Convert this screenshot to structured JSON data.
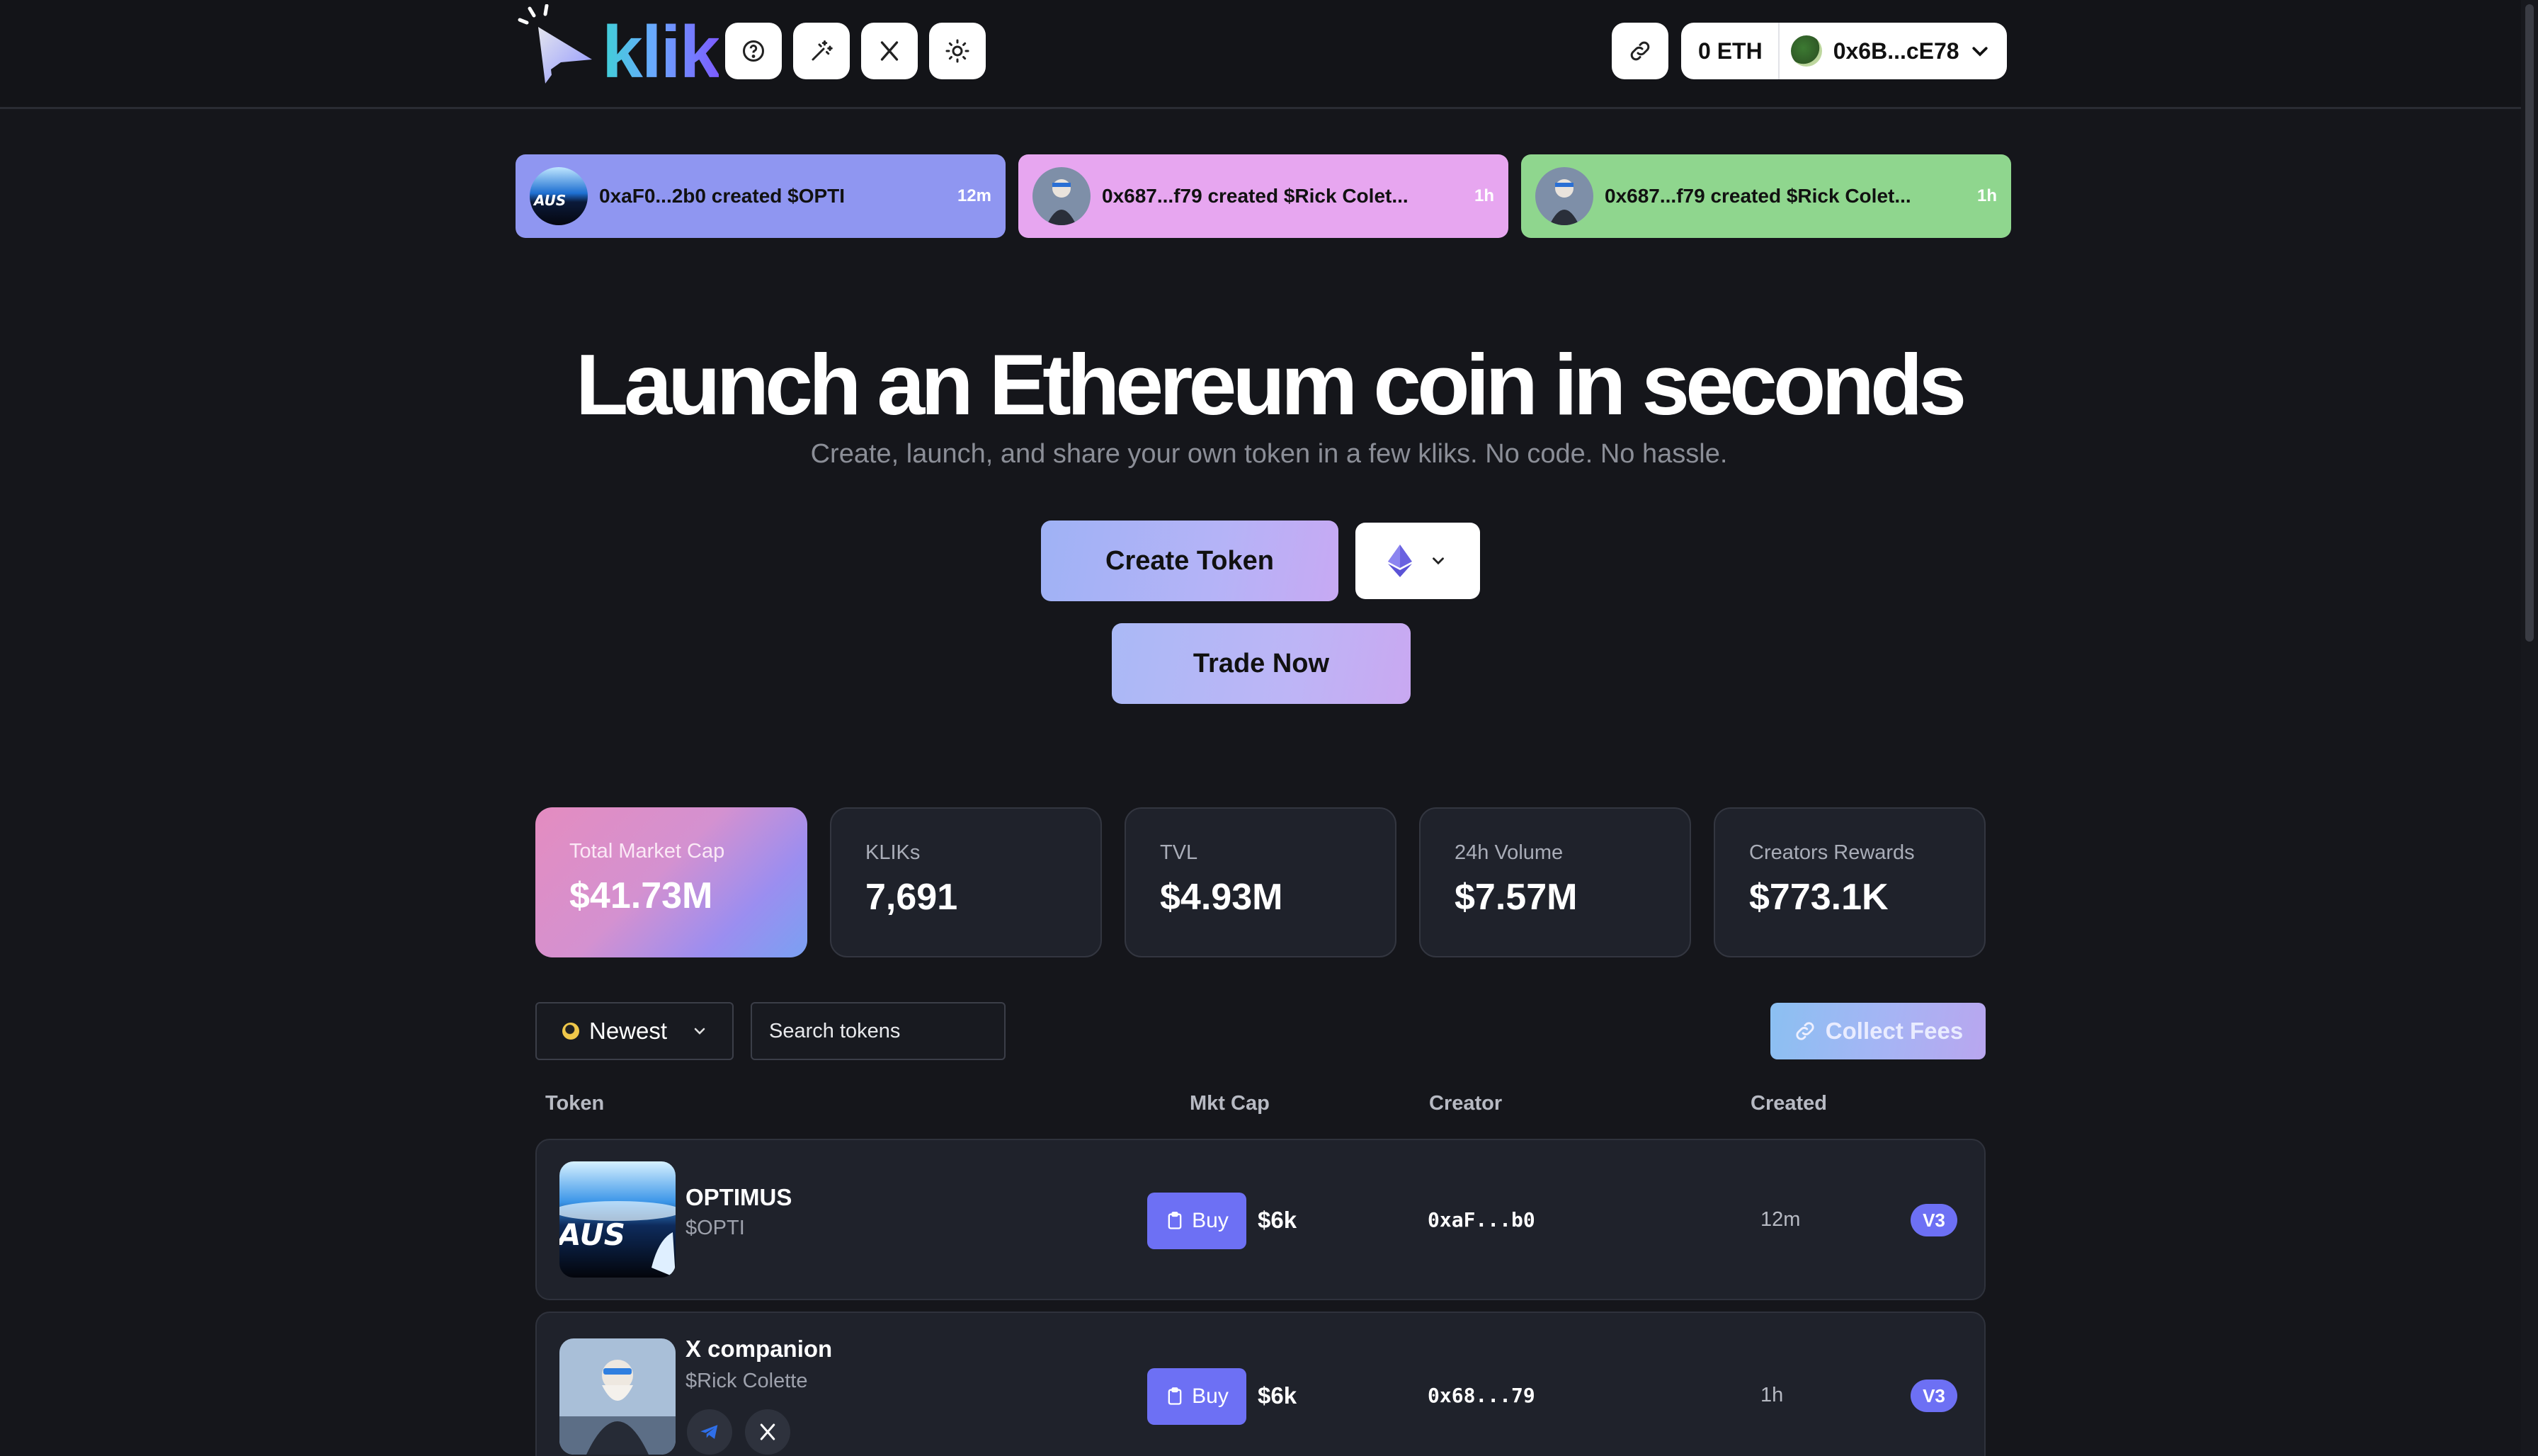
{
  "header": {
    "logo_text": "klik",
    "help_icon": "question-circle-icon",
    "tool_icon": "wand-icon",
    "x_icon": "x-logo-icon",
    "theme_icon": "sun-icon",
    "link_icon": "link-icon",
    "wallet": {
      "balance": "0 ETH",
      "address": "0x6B...cE78"
    }
  },
  "ticker": [
    {
      "text": "0xaF0...2b0 created $OPTI",
      "time": "12m",
      "color": "#8f96f1"
    },
    {
      "text": "0x687...f79 created $Rick Colet...",
      "time": "1h",
      "color": "#e7a6f0"
    },
    {
      "text": "0x687...f79 created $Rick Colet...",
      "time": "1h",
      "color": "#8fd68e"
    }
  ],
  "hero": {
    "title": "Launch an Ethereum coin in seconds",
    "subtitle": "Create, launch, and share your own token in a few kliks. No code. No hassle.",
    "create_label": "Create Token",
    "trade_label": "Trade Now",
    "chain_icon": "ethereum-icon"
  },
  "stats": [
    {
      "label": "Total Market Cap",
      "value": "$41.73M"
    },
    {
      "label": "KLIKs",
      "value": "7,691"
    },
    {
      "label": "TVL",
      "value": "$4.93M"
    },
    {
      "label": "24h Volume",
      "value": "$7.57M"
    },
    {
      "label": "Creators Rewards",
      "value": "$773.1K"
    }
  ],
  "filters": {
    "sort_selected": "Newest",
    "search_placeholder": "Search tokens",
    "collect_label": "Collect Fees"
  },
  "table": {
    "headers": {
      "token": "Token",
      "mktcap": "Mkt Cap",
      "creator": "Creator",
      "created": "Created"
    },
    "rows": [
      {
        "name": "OPTIMUS",
        "symbol": "$OPTI",
        "buy": "Buy",
        "mktcap": "$6k",
        "creator": "0xaF...b0",
        "created": "12m",
        "version": "V3"
      },
      {
        "name": "X companion",
        "symbol": "$Rick Colette",
        "buy": "Buy",
        "mktcap": "$6k",
        "creator": "0x68...79",
        "created": "1h",
        "version": "V3"
      }
    ]
  }
}
